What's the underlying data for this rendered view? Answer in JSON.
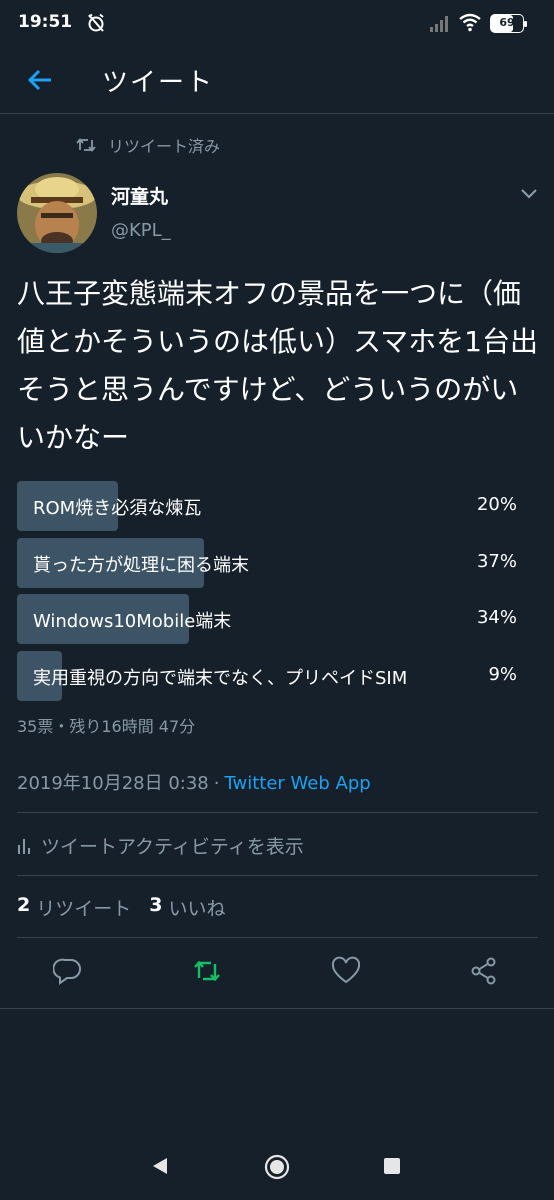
{
  "status_bar": {
    "time": "19:51",
    "battery": "69",
    "battery_fraction": 0.69
  },
  "header": {
    "title": "ツイート"
  },
  "retweet_context": {
    "label": "リツイート済み"
  },
  "author": {
    "name": "河童丸",
    "handle": "@KPL_"
  },
  "tweet": {
    "text": "八王子変態端末オフの景品を一つに（価値とかそういうのは低い）スマホを1台出そうと思うんですけど、どういうのがいいかなー"
  },
  "poll": {
    "options": [
      {
        "label": "ROM焼き必須な煉瓦",
        "percent": "20%",
        "value": 20
      },
      {
        "label": "貰った方が処理に困る端末",
        "percent": "37%",
        "value": 37
      },
      {
        "label": "Windows10Mobile端末",
        "percent": "34%",
        "value": 34
      },
      {
        "label": "実用重視の方向で端末でなく、プリペイドSIM",
        "percent": "9%",
        "value": 9
      }
    ],
    "meta": "35票・残り16時間 47分"
  },
  "timestamp": {
    "date": "2019年10月28日 0:38",
    "separator": "·",
    "source": "Twitter Web App"
  },
  "activity": {
    "label": "ツイートアクティビティを表示"
  },
  "stats": {
    "retweet_count": "2",
    "retweet_label": "リツイート",
    "like_count": "3",
    "like_label": "いいね"
  },
  "actions": {
    "reply_icon": "reply-icon",
    "retweet_icon": "retweet-icon",
    "like_icon": "heart-icon",
    "share_icon": "share-icon"
  },
  "colors": {
    "background": "#15202b",
    "accent": "#1da1f2",
    "retweet_active": "#17bf63",
    "secondary_text": "#8899a6",
    "poll_bar": "#3d5466"
  }
}
